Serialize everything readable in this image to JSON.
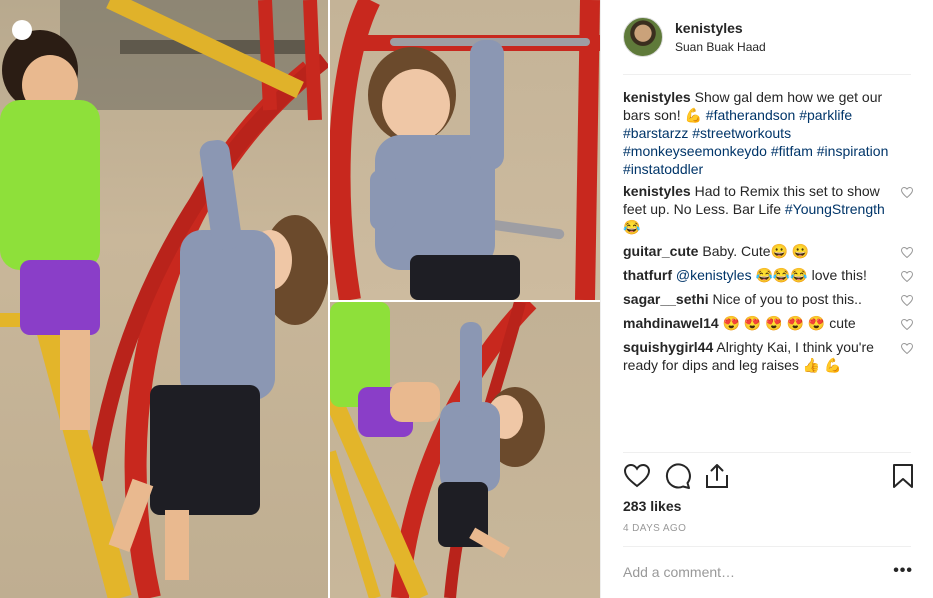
{
  "post": {
    "username": "kenistyles",
    "location": "Suan Buak Haad",
    "caption": {
      "user": "kenistyles",
      "text_a": "Show gal dem how we get our bars son! 💪 ",
      "tags": "#fatherandson #parklife #barstarzz #streetworkouts #monkeyseemonkeydo #fitfam #inspiration #instatoddler"
    },
    "comments": [
      {
        "user": "kenistyles",
        "text": "Had to Remix this set to show feet up. No Less. Bar Life ",
        "tag": "#YoungStrength",
        "tail": " 😂"
      },
      {
        "user": "guitar_cute",
        "text": "Baby. Cute😀 😀",
        "tag": "",
        "tail": ""
      },
      {
        "user": "thatfurf",
        "text": "",
        "tag": "@kenistyles",
        "tail": " 😂😂😂 love this!"
      },
      {
        "user": "sagar__sethi",
        "text": "Nice of you to post this..",
        "tag": "",
        "tail": ""
      },
      {
        "user": "mahdinawel14",
        "text": "😍 😍 😍 😍 😍 cute",
        "tag": "",
        "tail": ""
      },
      {
        "user": "squishygirl44",
        "text": "Alrighty Kai, I think you're ready for dips and leg raises 👍 💪",
        "tag": "",
        "tail": ""
      }
    ],
    "likes": "283 likes",
    "date": "4 DAYS AGO",
    "add_comment_placeholder": "Add a comment…",
    "more": "•••"
  },
  "icons": {
    "like": "heart-icon",
    "comment": "comment-icon",
    "share": "share-icon",
    "save": "bookmark-icon",
    "comment_like": "heart-icon"
  },
  "colors": {
    "link": "#003569",
    "muted": "#999999",
    "text": "#262626",
    "border": "#efefef"
  }
}
